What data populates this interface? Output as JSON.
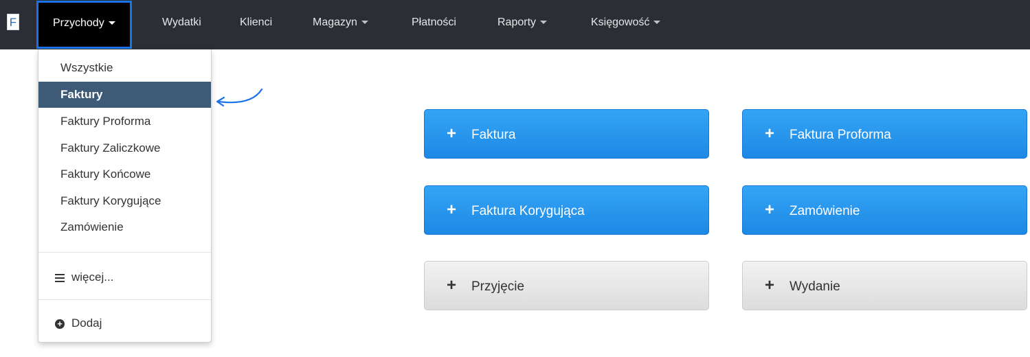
{
  "logo": {
    "letter": "F"
  },
  "nav": {
    "items": [
      {
        "label": "Przychody",
        "dropdown": true,
        "active": true
      },
      {
        "label": "Wydatki",
        "dropdown": false
      },
      {
        "label": "Klienci",
        "dropdown": false
      },
      {
        "label": "Magazyn",
        "dropdown": true
      },
      {
        "label": "Płatności",
        "dropdown": false
      },
      {
        "label": "Raporty",
        "dropdown": true
      },
      {
        "label": "Księgowość",
        "dropdown": true
      }
    ]
  },
  "dropdown": {
    "items": [
      {
        "label": "Wszystkie"
      },
      {
        "label": "Faktury",
        "selected": true
      },
      {
        "label": "Faktury Proforma"
      },
      {
        "label": "Faktury Zaliczkowe"
      },
      {
        "label": "Faktury Końcowe"
      },
      {
        "label": "Faktury Korygujące"
      },
      {
        "label": "Zamówienie"
      }
    ],
    "more_label": "więcej...",
    "add_label": "Dodaj"
  },
  "actions": [
    {
      "label": "Faktura",
      "style": "blue"
    },
    {
      "label": "Faktura Proforma",
      "style": "blue"
    },
    {
      "label": "Faktura Korygująca",
      "style": "blue"
    },
    {
      "label": "Zamówienie",
      "style": "blue"
    },
    {
      "label": "Przyjęcie",
      "style": "gray"
    },
    {
      "label": "Wydanie",
      "style": "gray"
    }
  ],
  "colors": {
    "topbar": "#2b2f35",
    "highlight_border": "#1a73e8",
    "selected_item": "#3d5a76",
    "button_blue": "#1e88e5",
    "button_gray": "#dcdcdc"
  }
}
